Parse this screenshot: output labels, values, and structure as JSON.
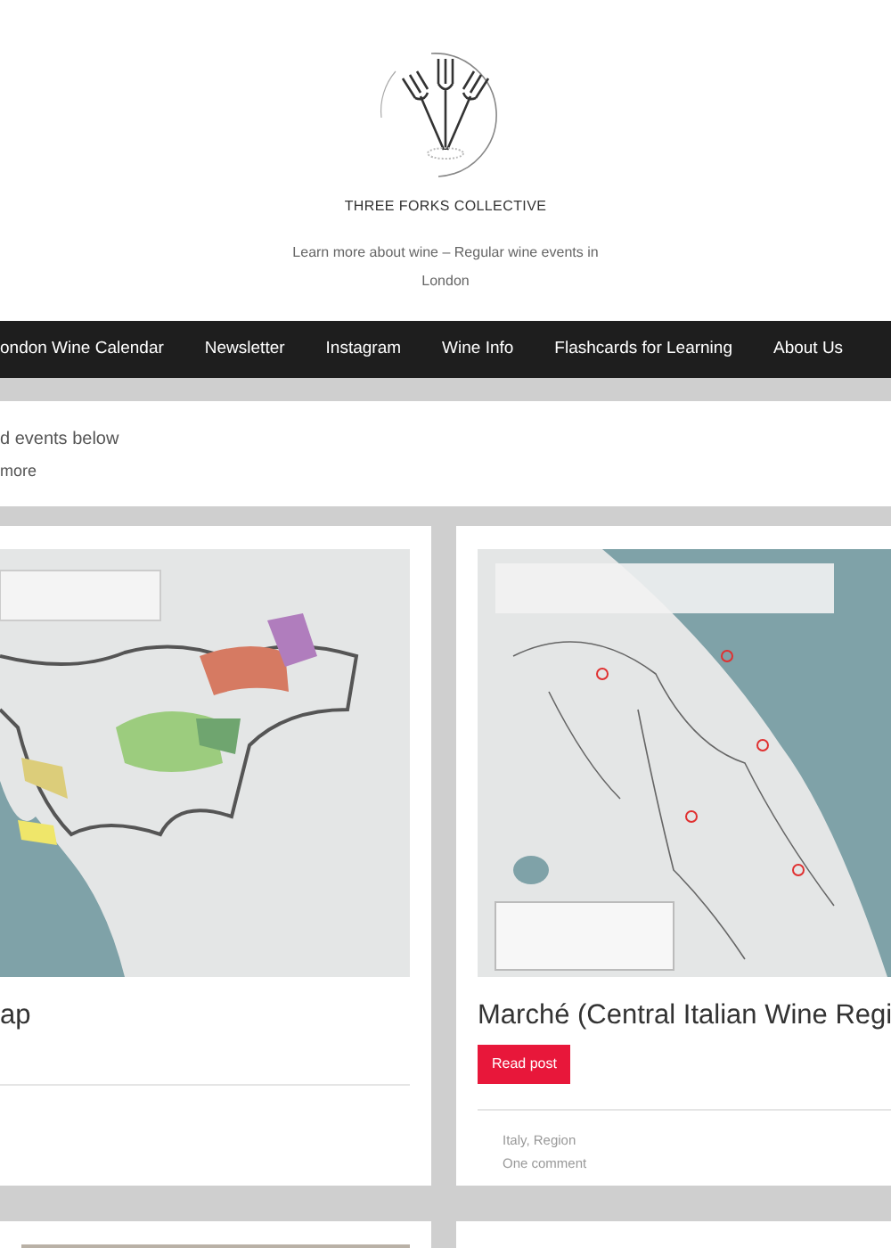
{
  "site": {
    "title": "THREE FORKS COLLECTIVE",
    "tagline": "Learn more about wine – Regular wine events in London"
  },
  "nav": [
    {
      "label": "ondon Wine Calendar"
    },
    {
      "label": "Newsletter"
    },
    {
      "label": "Instagram"
    },
    {
      "label": "Wine Info"
    },
    {
      "label": "Flashcards for Learning"
    },
    {
      "label": "About Us"
    }
  ],
  "intro": {
    "text": "d events below",
    "link": "more"
  },
  "posts": [
    {
      "title": "ap",
      "kind": "map"
    },
    {
      "title": "Marché (Central Italian Wine Regi",
      "kind": "map",
      "button": "Read post",
      "categories": "Italy, Region",
      "comments": "One comment"
    }
  ],
  "lower_posts": [
    {
      "kind": "photo"
    },
    {
      "kind": "blank"
    }
  ]
}
